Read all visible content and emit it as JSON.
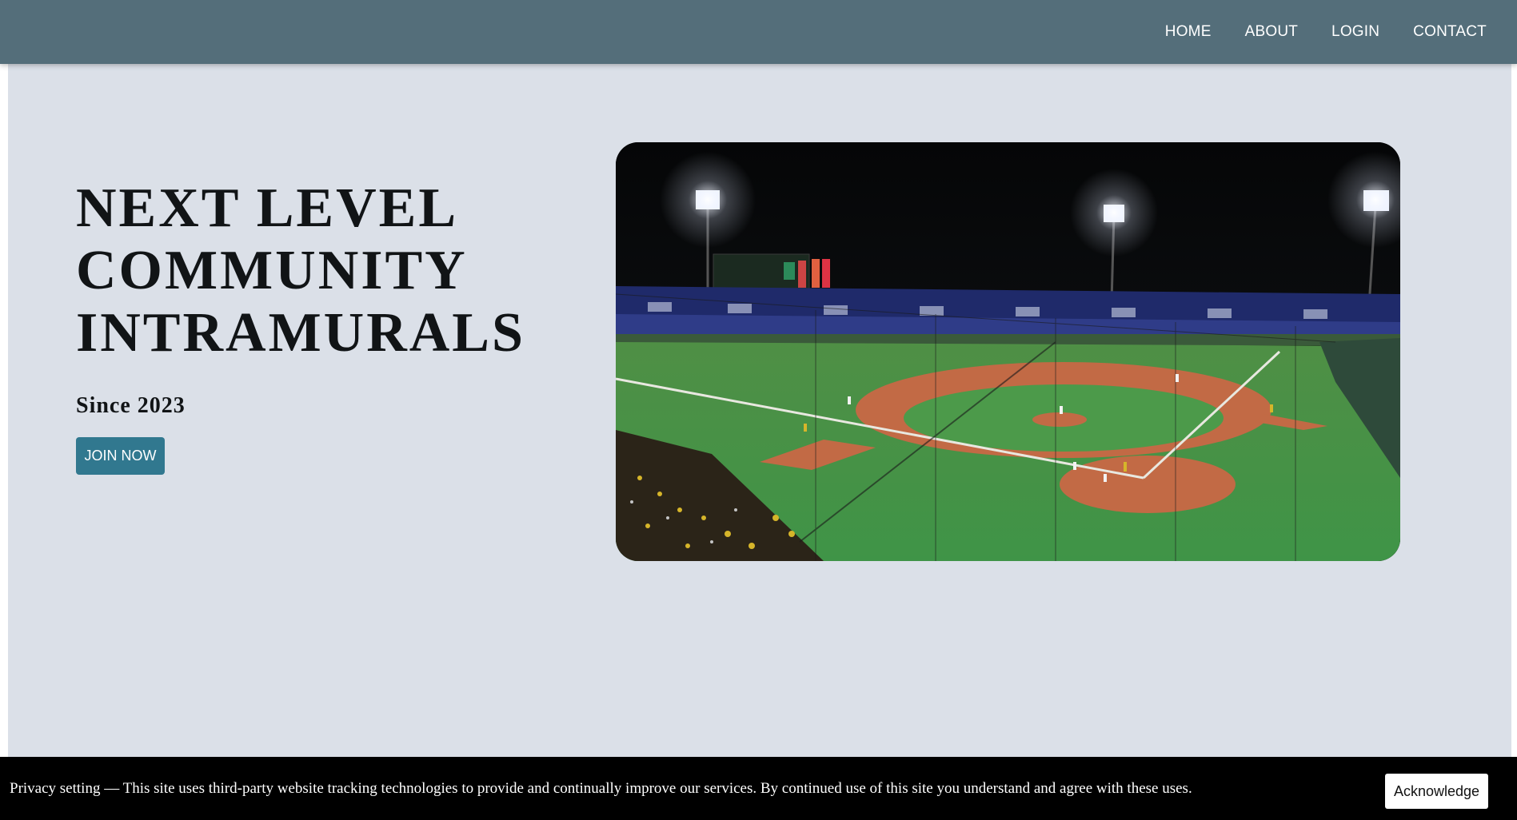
{
  "nav": {
    "links": [
      {
        "label": "HOME"
      },
      {
        "label": "ABOUT"
      },
      {
        "label": "LOGIN"
      },
      {
        "label": "CONTACT"
      }
    ]
  },
  "hero": {
    "title": "NEXT LEVEL\nCOMMUNITY\nINTRAMURALS",
    "subtitle": "Since 2023",
    "cta_label": "JOIN NOW",
    "image_subject": "night baseball stadium"
  },
  "cookie_banner": {
    "text": "Privacy setting — This site uses third-party website tracking technologies to provide and continually improve our services. By continued use of this site you understand and agree with these uses.",
    "button_label": "Acknowledge"
  },
  "colors": {
    "navbar": "#546e7a",
    "page_background": "#dbe0e8",
    "button": "#31788f",
    "banner": "#000000"
  }
}
